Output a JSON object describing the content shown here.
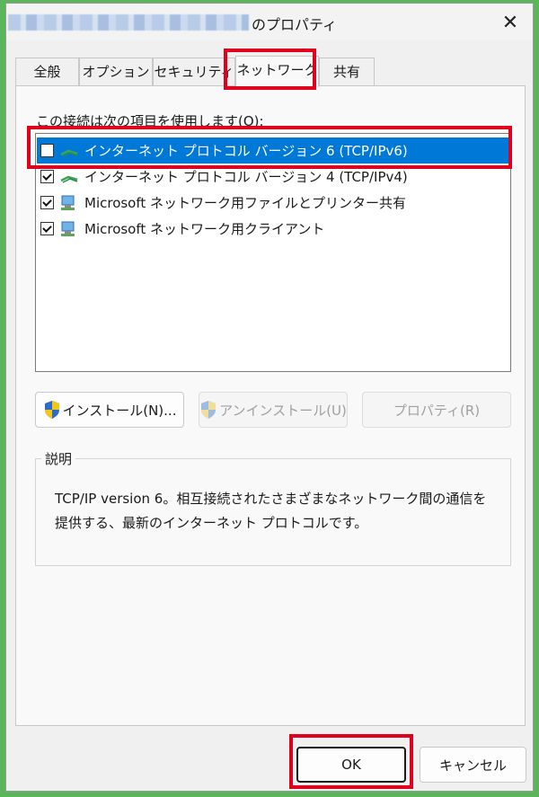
{
  "window": {
    "title_suffix": "のプロパティ",
    "close_glyph": "✕"
  },
  "tabs": [
    {
      "label": "全般"
    },
    {
      "label": "オプション"
    },
    {
      "label": "セキュリティ"
    },
    {
      "label": "ネットワーク",
      "active": true
    },
    {
      "label": "共有"
    }
  ],
  "network": {
    "items_label": "この接続は次の項目を使用します(O):",
    "items": [
      {
        "label": "インターネット プロトコル バージョン 6 (TCP/IPv6)",
        "checked": false,
        "selected": true,
        "icon": "network-protocol-icon"
      },
      {
        "label": "インターネット プロトコル バージョン 4 (TCP/IPv4)",
        "checked": true,
        "selected": false,
        "icon": "network-protocol-icon"
      },
      {
        "label": "Microsoft ネットワーク用ファイルとプリンター共有",
        "checked": true,
        "selected": false,
        "icon": "network-service-icon"
      },
      {
        "label": "Microsoft ネットワーク用クライアント",
        "checked": true,
        "selected": false,
        "icon": "network-client-icon"
      }
    ],
    "install_label": "インストール(N)...",
    "uninstall_label": "アンインストール(U)",
    "properties_label": "プロパティ(R)"
  },
  "description": {
    "legend": "説明",
    "text": "TCP/IP version 6。相互接続されたさまざまなネットワーク間の通信を提供する、最新のインターネット プロトコルです。"
  },
  "footer": {
    "ok_label": "OK",
    "cancel_label": "キャンセル"
  },
  "colors": {
    "selection": "#0078d7",
    "highlight": "#e0001b",
    "frame": "#5bb55b"
  }
}
